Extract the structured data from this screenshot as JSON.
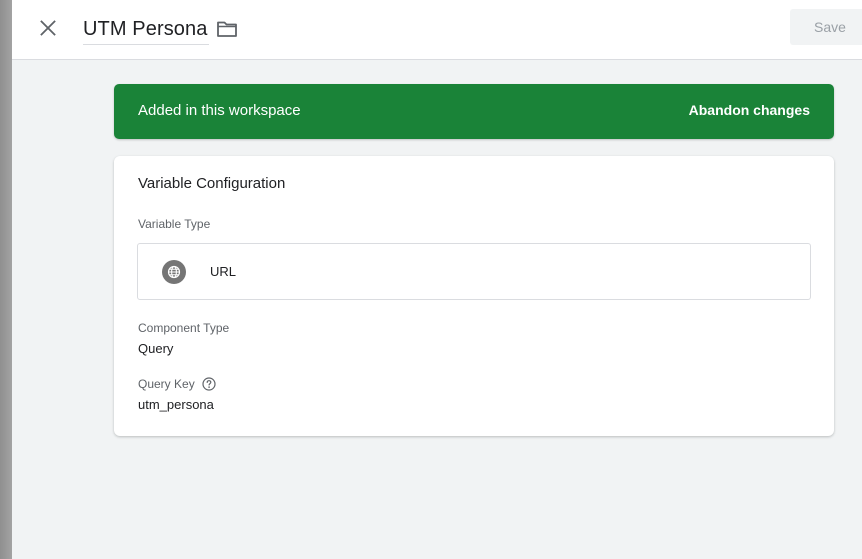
{
  "header": {
    "title": "UTM Persona",
    "save_label": "Save"
  },
  "banner": {
    "text": "Added in this workspace",
    "action_label": "Abandon changes",
    "color": "#1a8338"
  },
  "config": {
    "title": "Variable Configuration",
    "variable_type_label": "Variable Type",
    "variable_type_value": "URL",
    "variable_type_icon": "globe-icon",
    "component_type_label": "Component Type",
    "component_type_value": "Query",
    "query_key_label": "Query Key",
    "query_key_value": "utm_persona"
  },
  "icons": {
    "close": "close-icon",
    "folder": "folder-icon",
    "help": "help-icon"
  }
}
